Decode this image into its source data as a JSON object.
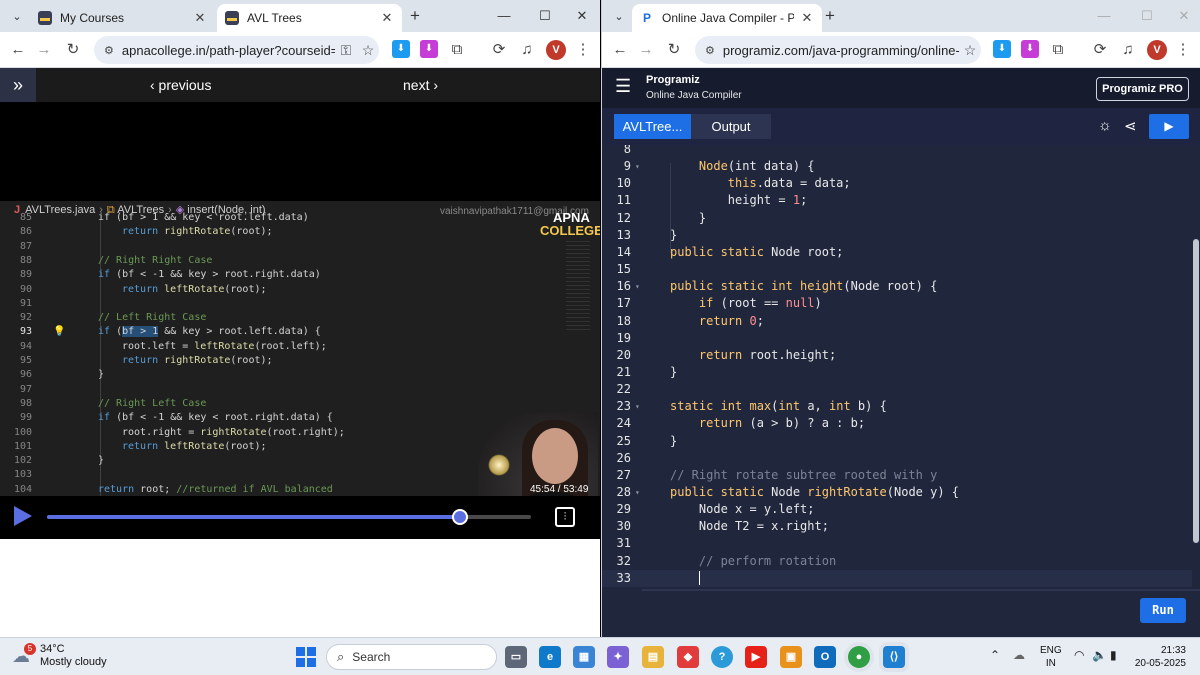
{
  "left_browser": {
    "tabs": [
      {
        "title": "My Courses",
        "active": false
      },
      {
        "title": "AVL Trees",
        "active": true
      }
    ],
    "url": "apnacollege.in/path-player?courseid=s...",
    "avatar": "V",
    "nav": {
      "prev": "‹ previous",
      "next": "next ›"
    },
    "video": {
      "breadcrumb": {
        "file": "AVLTrees.java",
        "cls": "AVLTrees",
        "method": "insert(Node, int)"
      },
      "watermark": "vaishnavipathak1711@gmail.com",
      "logo": {
        "line1": "APNA",
        "line2": "COLLEGE"
      },
      "time": "45:54 / 53:49",
      "progress_fraction": 0.853,
      "code": [
        {
          "n": "85",
          "parts": [
            [
              "tx",
              "if (bf > 1 && key < root.left.data)"
            ]
          ],
          "indent": 0
        },
        {
          "n": "86",
          "parts": [
            [
              "kw",
              "return "
            ],
            [
              "fn",
              "rightRotate"
            ],
            [
              "tx",
              "(root);"
            ]
          ],
          "indent": 1
        },
        {
          "n": "87",
          "parts": [],
          "indent": 0
        },
        {
          "n": "88",
          "parts": [
            [
              "cm",
              "// Right Right Case"
            ]
          ],
          "indent": 0
        },
        {
          "n": "89",
          "parts": [
            [
              "kw",
              "if "
            ],
            [
              "tx",
              "(bf < -1 && key > root.right.data)"
            ]
          ],
          "indent": 0
        },
        {
          "n": "90",
          "parts": [
            [
              "kw",
              "return "
            ],
            [
              "fn",
              "leftRotate"
            ],
            [
              "tx",
              "(root);"
            ]
          ],
          "indent": 1
        },
        {
          "n": "91",
          "parts": [],
          "indent": 0
        },
        {
          "n": "92",
          "parts": [
            [
              "cm",
              "// Left Right Case"
            ]
          ],
          "indent": 0
        },
        {
          "n": "93",
          "parts": [
            [
              "kw",
              "if "
            ],
            [
              "tx",
              "("
            ],
            [
              "hl",
              "bf > 1"
            ],
            [
              "tx",
              " && key > root.left.data) {"
            ]
          ],
          "indent": 0,
          "cur": true
        },
        {
          "n": "94",
          "parts": [
            [
              "tx",
              "root.left = "
            ],
            [
              "fn",
              "leftRotate"
            ],
            [
              "tx",
              "(root.left);"
            ]
          ],
          "indent": 1
        },
        {
          "n": "95",
          "parts": [
            [
              "kw",
              "return "
            ],
            [
              "fn",
              "rightRotate"
            ],
            [
              "tx",
              "(root);"
            ]
          ],
          "indent": 1
        },
        {
          "n": "96",
          "parts": [
            [
              "tx",
              "}"
            ]
          ],
          "indent": 0
        },
        {
          "n": "97",
          "parts": [],
          "indent": 0
        },
        {
          "n": "98",
          "parts": [
            [
              "cm",
              "// Right Left Case"
            ]
          ],
          "indent": 0
        },
        {
          "n": "99",
          "parts": [
            [
              "kw",
              "if "
            ],
            [
              "tx",
              "(bf < -1 && key < root.right.data) {"
            ]
          ],
          "indent": 0
        },
        {
          "n": "100",
          "parts": [
            [
              "tx",
              "root.right = "
            ],
            [
              "fn",
              "rightRotate"
            ],
            [
              "tx",
              "(root.right);"
            ]
          ],
          "indent": 1
        },
        {
          "n": "101",
          "parts": [
            [
              "kw",
              "return "
            ],
            [
              "fn",
              "leftRotate"
            ],
            [
              "tx",
              "(root);"
            ]
          ],
          "indent": 1
        },
        {
          "n": "102",
          "parts": [
            [
              "tx",
              "}"
            ]
          ],
          "indent": 0
        },
        {
          "n": "103",
          "parts": [],
          "indent": 0
        },
        {
          "n": "104",
          "parts": [
            [
              "kw",
              "return "
            ],
            [
              "tx",
              "root; "
            ],
            [
              "cm",
              "//returned if AVL balanced"
            ]
          ],
          "indent": 0
        }
      ]
    }
  },
  "right_browser": {
    "tabs": [
      {
        "title": "Online Java Compiler - Program",
        "active": true
      }
    ],
    "url": "programiz.com/java-programming/online-c...",
    "avatar": "V",
    "brand": "Programiz",
    "subtitle": "Online Java Compiler",
    "pro": "Programiz PRO",
    "file_tab": "AVLTree...",
    "output_tab": "Output",
    "run": "Run",
    "code": [
      {
        "n": "8",
        "fold": false,
        "parts": []
      },
      {
        "n": "9",
        "fold": true,
        "parts": [
          [
            "t2",
            "    "
          ],
          [
            "fn2",
            "Node"
          ],
          [
            "t2",
            "(int data) {"
          ]
        ]
      },
      {
        "n": "10",
        "fold": false,
        "parts": [
          [
            "t2",
            "        "
          ],
          [
            "kw2",
            "this"
          ],
          [
            "t2",
            ".data = data;"
          ]
        ]
      },
      {
        "n": "11",
        "fold": false,
        "parts": [
          [
            "t2",
            "        height = "
          ],
          [
            "nm2",
            "1"
          ],
          [
            "t2",
            ";"
          ]
        ]
      },
      {
        "n": "12",
        "fold": false,
        "parts": [
          [
            "t2",
            "    }"
          ]
        ]
      },
      {
        "n": "13",
        "fold": false,
        "parts": [
          [
            "t2",
            "}"
          ]
        ]
      },
      {
        "n": "14",
        "fold": false,
        "parts": [
          [
            "kw2",
            "public static "
          ],
          [
            "t2",
            "Node root;"
          ]
        ]
      },
      {
        "n": "15",
        "fold": false,
        "parts": []
      },
      {
        "n": "16",
        "fold": true,
        "parts": [
          [
            "kw2",
            "public static int "
          ],
          [
            "fn2",
            "height"
          ],
          [
            "t2",
            "(Node root) {"
          ]
        ]
      },
      {
        "n": "17",
        "fold": false,
        "parts": [
          [
            "t2",
            "    "
          ],
          [
            "kw2",
            "if "
          ],
          [
            "t2",
            "(root == "
          ],
          [
            "nm2",
            "null"
          ],
          [
            "t2",
            ")"
          ]
        ]
      },
      {
        "n": "18",
        "fold": false,
        "parts": [
          [
            "t2",
            "    "
          ],
          [
            "kw2",
            "return "
          ],
          [
            "nm2",
            "0"
          ],
          [
            "t2",
            ";"
          ]
        ]
      },
      {
        "n": "19",
        "fold": false,
        "parts": []
      },
      {
        "n": "20",
        "fold": false,
        "parts": [
          [
            "t2",
            "    "
          ],
          [
            "kw2",
            "return "
          ],
          [
            "t2",
            "root.height;"
          ]
        ]
      },
      {
        "n": "21",
        "fold": false,
        "parts": [
          [
            "t2",
            "}"
          ]
        ]
      },
      {
        "n": "22",
        "fold": false,
        "parts": []
      },
      {
        "n": "23",
        "fold": true,
        "parts": [
          [
            "kw2",
            "static int "
          ],
          [
            "fn2",
            "max"
          ],
          [
            "t2",
            "("
          ],
          [
            "kw2",
            "int "
          ],
          [
            "t2",
            "a, "
          ],
          [
            "kw2",
            "int "
          ],
          [
            "t2",
            "b) {"
          ]
        ]
      },
      {
        "n": "24",
        "fold": false,
        "parts": [
          [
            "t2",
            "    "
          ],
          [
            "kw2",
            "return "
          ],
          [
            "t2",
            "(a > b) ? a : b;"
          ]
        ]
      },
      {
        "n": "25",
        "fold": false,
        "parts": [
          [
            "t2",
            "}"
          ]
        ]
      },
      {
        "n": "26",
        "fold": false,
        "parts": []
      },
      {
        "n": "27",
        "fold": false,
        "parts": [
          [
            "cm2",
            "// Right rotate subtree rooted with y"
          ]
        ]
      },
      {
        "n": "28",
        "fold": true,
        "parts": [
          [
            "kw2",
            "public static "
          ],
          [
            "t2",
            "Node "
          ],
          [
            "fn2",
            "rightRotate"
          ],
          [
            "t2",
            "(Node y) {"
          ]
        ]
      },
      {
        "n": "29",
        "fold": false,
        "parts": [
          [
            "t2",
            "    Node x = y.left;"
          ]
        ]
      },
      {
        "n": "30",
        "fold": false,
        "parts": [
          [
            "t2",
            "    Node T2 = x.right;"
          ]
        ]
      },
      {
        "n": "31",
        "fold": false,
        "parts": []
      },
      {
        "n": "32",
        "fold": false,
        "parts": [
          [
            "cm2",
            "    // perform rotation"
          ]
        ]
      },
      {
        "n": "33",
        "fold": false,
        "parts": [
          [
            "t2",
            "    "
          ]
        ],
        "cur": true
      }
    ]
  },
  "taskbar": {
    "weather": {
      "temp": "34°C",
      "desc": "Mostly cloudy",
      "badge": "5"
    },
    "search": "Search",
    "lang": {
      "line1": "ENG",
      "line2": "IN"
    },
    "time": "21:33",
    "date": "20-05-2025"
  },
  "colors": {
    "accent": "#1e6fe6",
    "video_accent": "#5b6ee1",
    "taskbar": "#e8ecf3"
  }
}
